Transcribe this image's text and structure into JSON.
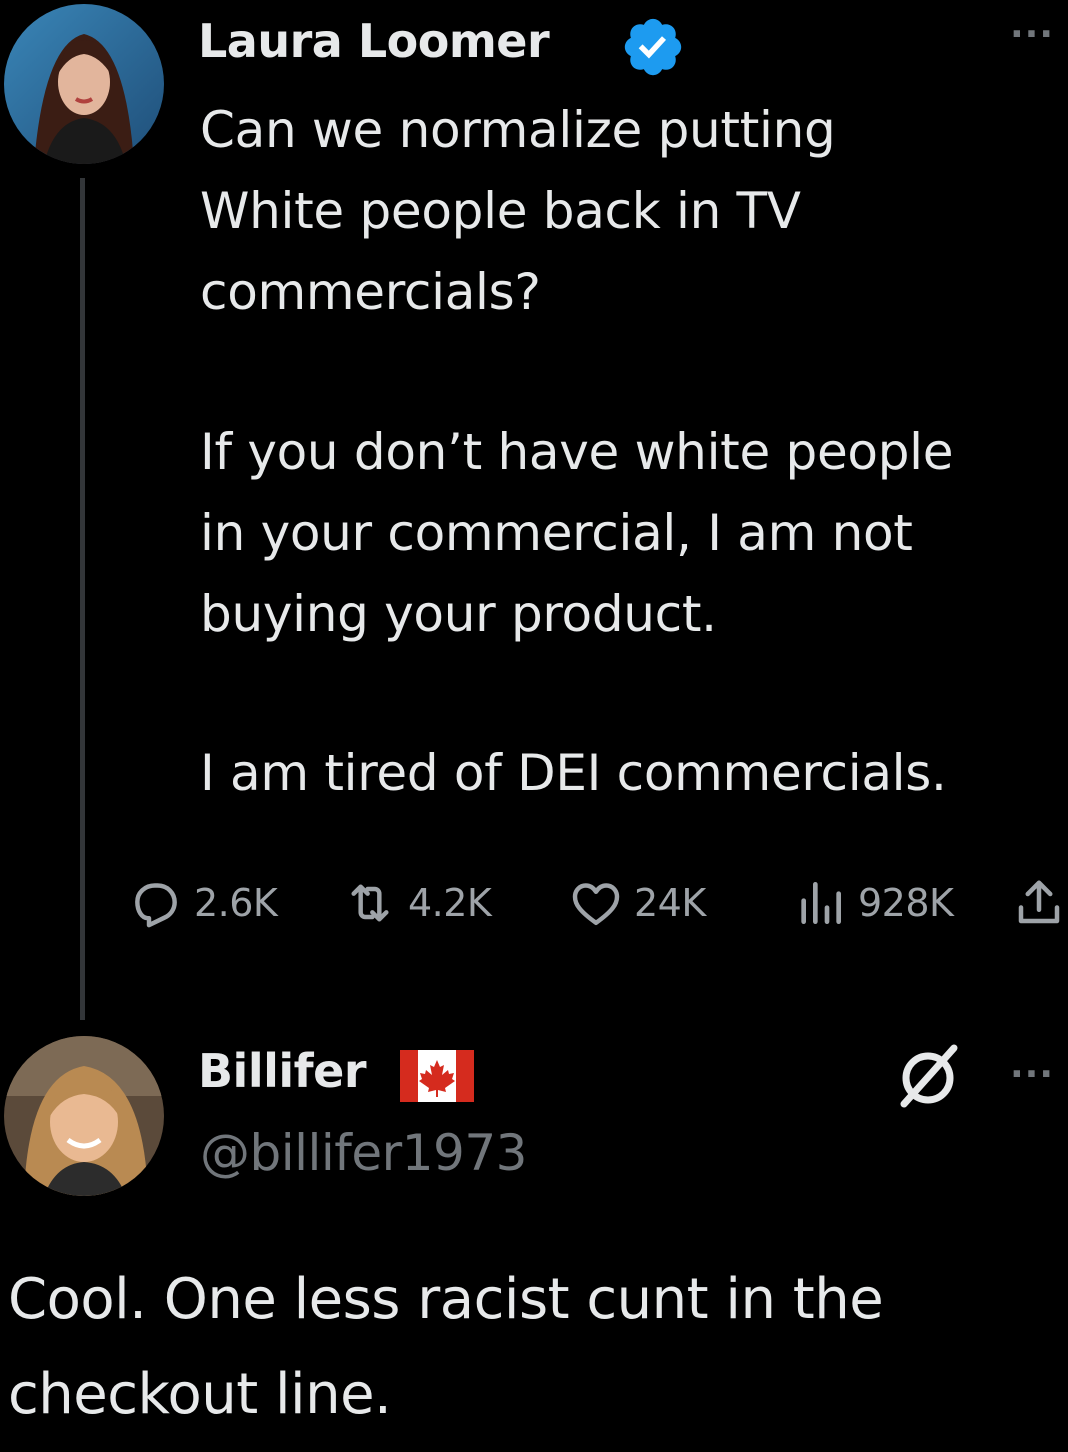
{
  "tweet": {
    "author_name": "Laura Loomer",
    "verified_icon": "verified-badge-icon",
    "more_icon": "more-dots-icon",
    "paragraphs": [
      [
        "Can we normalize putting",
        "White people back in TV",
        "commercials?"
      ],
      [
        "If you don’t have white people",
        "in your commercial, I am not",
        "buying your product."
      ],
      [
        "I am tired of DEI commercials."
      ]
    ],
    "actions": {
      "replies": "2.6K",
      "retweets": "4.2K",
      "likes": "24K",
      "views": "928K",
      "share_icon": "share-icon"
    }
  },
  "reply": {
    "author_name": "Billifer",
    "flag_icon": "canada-flag-icon",
    "handle": "@billifer1973",
    "badge_icon": "no-sign-icon",
    "more_icon": "more-dots-icon",
    "lines": [
      "Cool. One less racist cunt in the",
      "checkout line."
    ]
  },
  "colors": {
    "background": "#000000",
    "text": "#e7e9ea",
    "muted": "#71767b",
    "verified": "#1d9bf0",
    "thread_line": "#333639"
  }
}
